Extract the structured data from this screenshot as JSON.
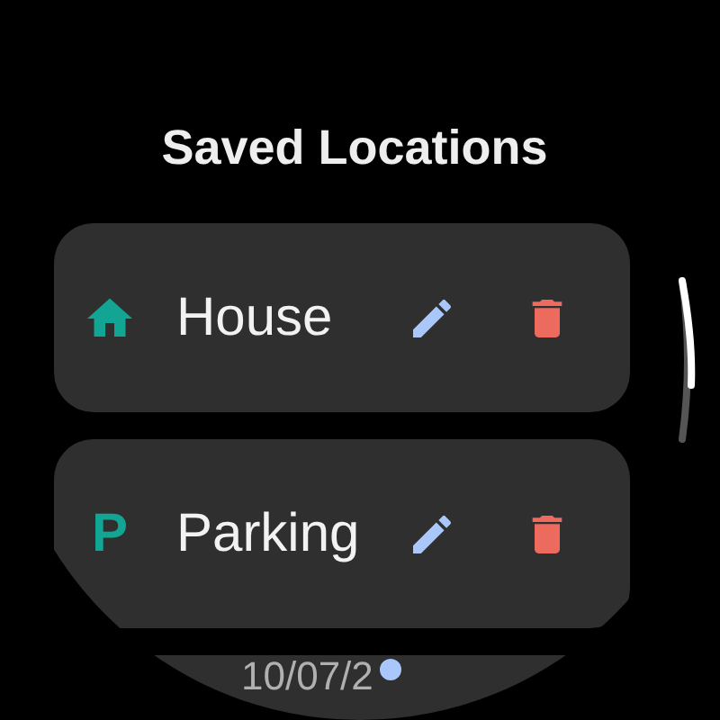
{
  "title": "Saved Locations",
  "locations": [
    {
      "kind": "home",
      "name": "House"
    },
    {
      "kind": "glyph",
      "glyph": "P",
      "name": "Parking"
    }
  ],
  "next_card": {
    "text": "10/07/2"
  }
}
